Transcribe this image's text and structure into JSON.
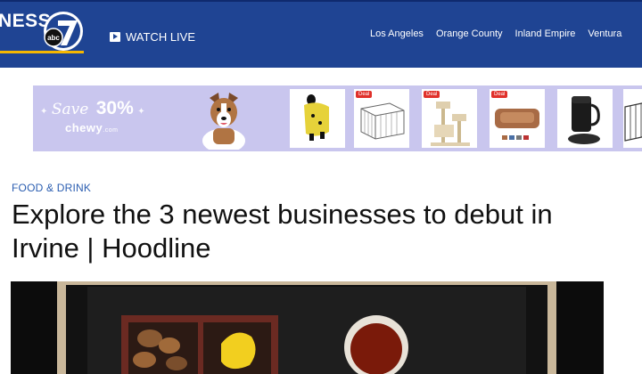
{
  "header": {
    "brand_partial": "NESS",
    "logo_text": "abc",
    "logo_number": "7",
    "watch_live": "WATCH LIVE",
    "nav": [
      "Los Angeles",
      "Orange County",
      "Inland Empire",
      "Ventura"
    ]
  },
  "ad": {
    "save_word": "Save",
    "percent": "30%",
    "brand": "chewy",
    "brand_suffix": ".com",
    "deal_label": "Deal",
    "up_arrow": "▲",
    "down_arrow": "▼"
  },
  "article": {
    "category": "FOOD & DRINK",
    "headline": "Explore the 3 newest businesses to debut in Irvine | Hoodline"
  },
  "colors": {
    "header_bg": "#1f4493",
    "accent_rule": "#f5b700",
    "ad_bg": "#c9c6ee",
    "category": "#2a5db0"
  }
}
